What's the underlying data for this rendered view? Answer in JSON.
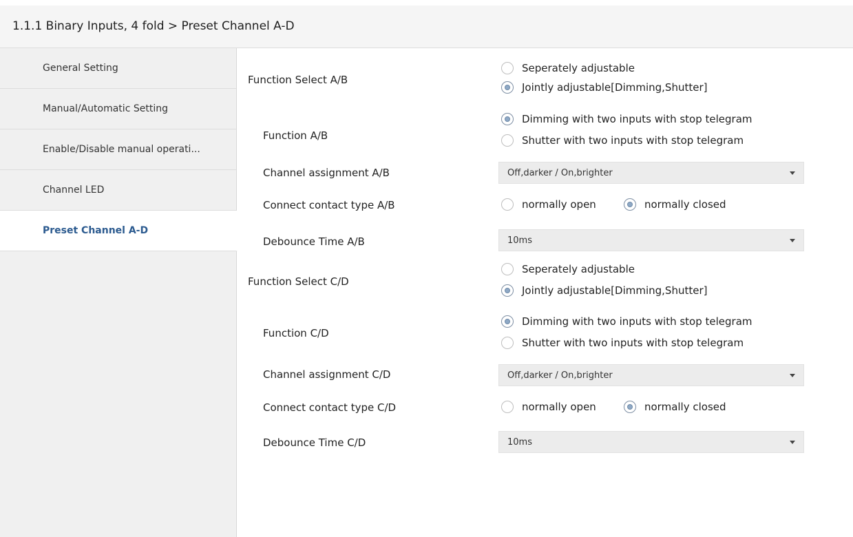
{
  "header": {
    "title": "1.1.1 Binary Inputs, 4 fold > Preset Channel A-D"
  },
  "sidebar": {
    "items": [
      {
        "label": "General Setting"
      },
      {
        "label": "Manual/Automatic Setting"
      },
      {
        "label": "Enable/Disable manual operati..."
      },
      {
        "label": "Channel LED"
      },
      {
        "label": "Preset Channel A-D"
      }
    ],
    "active_index": 4
  },
  "params": {
    "ab": {
      "function_select": {
        "label": "Function Select A/B",
        "options": [
          "Seperately adjustable",
          "Jointly adjustable[Dimming,Shutter]"
        ],
        "selected": 1
      },
      "function": {
        "label": "Function A/B",
        "options": [
          "Dimming with two inputs with stop telegram",
          "Shutter with two inputs with stop telegram"
        ],
        "selected": 0
      },
      "channel_assignment": {
        "label": "Channel assignment A/B",
        "value": "Off,darker / On,brighter"
      },
      "contact_type": {
        "label": "Connect contact type A/B",
        "options": [
          "normally open",
          "normally closed"
        ],
        "selected": 1
      },
      "debounce": {
        "label": "Debounce Time A/B",
        "value": "10ms"
      }
    },
    "cd": {
      "function_select": {
        "label": "Function Select C/D",
        "options": [
          "Seperately adjustable",
          "Jointly adjustable[Dimming,Shutter]"
        ],
        "selected": 1
      },
      "function": {
        "label": "Function C/D",
        "options": [
          "Dimming with two inputs with stop telegram",
          "Shutter with two inputs with stop telegram"
        ],
        "selected": 0
      },
      "channel_assignment": {
        "label": "Channel assignment C/D",
        "value": "Off,darker / On,brighter"
      },
      "contact_type": {
        "label": "Connect contact type C/D",
        "options": [
          "normally open",
          "normally closed"
        ],
        "selected": 1
      },
      "debounce": {
        "label": "Debounce Time C/D",
        "value": "10ms"
      }
    }
  },
  "icons": {
    "dropdown": "chevron-down-icon",
    "radio": "radio-icon"
  },
  "colors": {
    "active_nav": "#2b5a8f",
    "radio_fill": "#8fa9c6"
  }
}
